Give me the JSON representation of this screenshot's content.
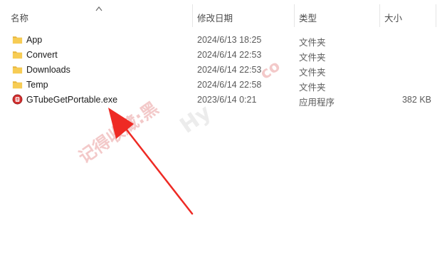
{
  "columns": {
    "name": "名称",
    "date": "修改日期",
    "type": "类型",
    "size": "大小"
  },
  "files": [
    {
      "name": "App",
      "date": "2024/6/13 18:25",
      "type": "文件夹",
      "size": "",
      "icon": "folder-icon"
    },
    {
      "name": "Convert",
      "date": "2024/6/14 22:53",
      "type": "文件夹",
      "size": "",
      "icon": "folder-icon"
    },
    {
      "name": "Downloads",
      "date": "2024/6/14 22:53",
      "type": "文件夹",
      "size": "",
      "icon": "folder-icon"
    },
    {
      "name": "Temp",
      "date": "2024/6/14 22:58",
      "type": "文件夹",
      "size": "",
      "icon": "folder-icon"
    },
    {
      "name": "GTubeGetPortable.exe",
      "date": "2023/6/14 0:21",
      "type": "应用程序",
      "size": "382 KB",
      "icon": "exe-app-icon"
    }
  ],
  "watermark": {
    "text1": "记得收藏:黑",
    "text2": "Hy",
    "text3": "co"
  },
  "colors": {
    "folder": "#f7cc54",
    "folder_dark": "#e6b43a",
    "app_red": "#d32f2f",
    "arrow": "#ee2a24",
    "watermark": "#f3c9c9"
  }
}
